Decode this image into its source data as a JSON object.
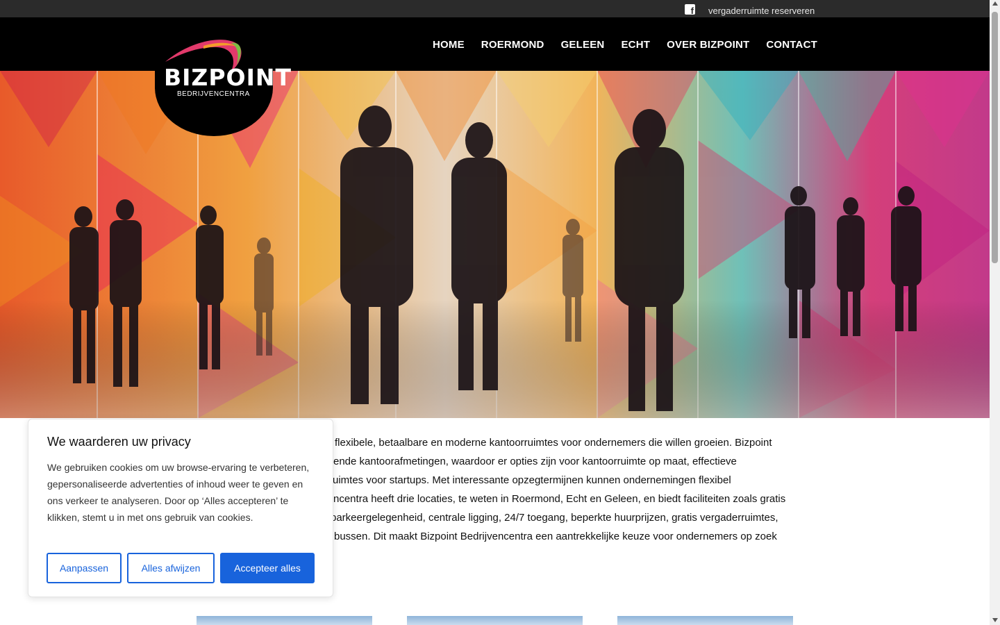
{
  "topbar": {
    "facebook_icon": "facebook-icon",
    "reserve_link": "vergaderruimte reserveren"
  },
  "header": {
    "nav": [
      "HOME",
      "ROERMOND",
      "GELEEN",
      "ECHT",
      "OVER BIZPOINT",
      "CONTACT"
    ]
  },
  "logo": {
    "title": "BIZPOINT",
    "subtitle": "BEDRIJVENCENTRA"
  },
  "intro": {
    "lines": [
      "flexibele, betaalbare en moderne kantoorruimtes voor ondernemers die willen groeien. Bizpoint",
      "ende kantoorafmetingen, waardoor er opties zijn voor kantoorruimte op maat, effectieve",
      "uimtes voor startups. Met interessante opzegtermijnen kunnen ondernemingen flexibel",
      "ncentra heeft drie locaties, te weten in Roermond, Echt en Geleen, en biedt faciliteiten zoals gratis",
      "parkeergelegenheid, centrale ligging, 24/7 toegang, beperkte huurprijzen, gratis vergaderruimtes,",
      "bussen. Dit maakt Bizpoint Bedrijvencentra een aantrekkelijke keuze voor ondernemers op zoek"
    ]
  },
  "cookie": {
    "title": "We waarderen uw privacy",
    "text": "We gebruiken cookies om uw browse-ervaring te verbeteren, gepersonaliseerde advertenties of inhoud weer te geven en ons verkeer te analyseren. Door op ‘Alles accepteren’ te klikken, stemt u in met ons gebruik van cookies.",
    "customize_label": "Aanpassen",
    "reject_label": "Alles afwijzen",
    "accept_label": "Accepteer alles",
    "accent_color": "#1863dc"
  }
}
